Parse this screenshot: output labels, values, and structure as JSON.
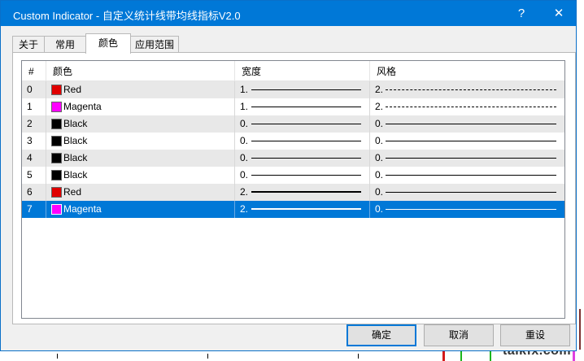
{
  "window": {
    "title": "Custom Indicator - 自定义统计线带均线指标V2.0",
    "help_label": "?",
    "close_label": "✕"
  },
  "tabs": [
    {
      "label": "关于"
    },
    {
      "label": "常用"
    },
    {
      "label": "颜色"
    },
    {
      "label": "应用范围"
    }
  ],
  "active_tab": "颜色",
  "table": {
    "headers": [
      "#",
      "颜色",
      "宽度",
      "风格"
    ],
    "rows": [
      {
        "index": "0",
        "color_name": "Red",
        "color": "#e00000",
        "width": "1.",
        "style": "2.",
        "line_width": 1,
        "style_type": "dashed"
      },
      {
        "index": "1",
        "color_name": "Magenta",
        "color": "#ff00ff",
        "width": "1.",
        "style": "2.",
        "line_width": 1,
        "style_type": "dashed"
      },
      {
        "index": "2",
        "color_name": "Black",
        "color": "#000000",
        "width": "0.",
        "style": "0.",
        "line_width": 1,
        "style_type": "solid"
      },
      {
        "index": "3",
        "color_name": "Black",
        "color": "#000000",
        "width": "0.",
        "style": "0.",
        "line_width": 1,
        "style_type": "solid"
      },
      {
        "index": "4",
        "color_name": "Black",
        "color": "#000000",
        "width": "0.",
        "style": "0.",
        "line_width": 1,
        "style_type": "solid"
      },
      {
        "index": "5",
        "color_name": "Black",
        "color": "#000000",
        "width": "0.",
        "style": "0.",
        "line_width": 1,
        "style_type": "solid"
      },
      {
        "index": "6",
        "color_name": "Red",
        "color": "#e00000",
        "width": "2.",
        "style": "0.",
        "line_width": 2,
        "style_type": "solid"
      },
      {
        "index": "7",
        "color_name": "Magenta",
        "color": "#ff00ff",
        "width": "2.",
        "style": "0.",
        "line_width": 2,
        "style_type": "solid",
        "selected": true
      }
    ]
  },
  "buttons": {
    "ok": "确定",
    "cancel": "取消",
    "reset": "重设"
  },
  "watermark": "talkfx.com",
  "accent_color": "#0078d7"
}
